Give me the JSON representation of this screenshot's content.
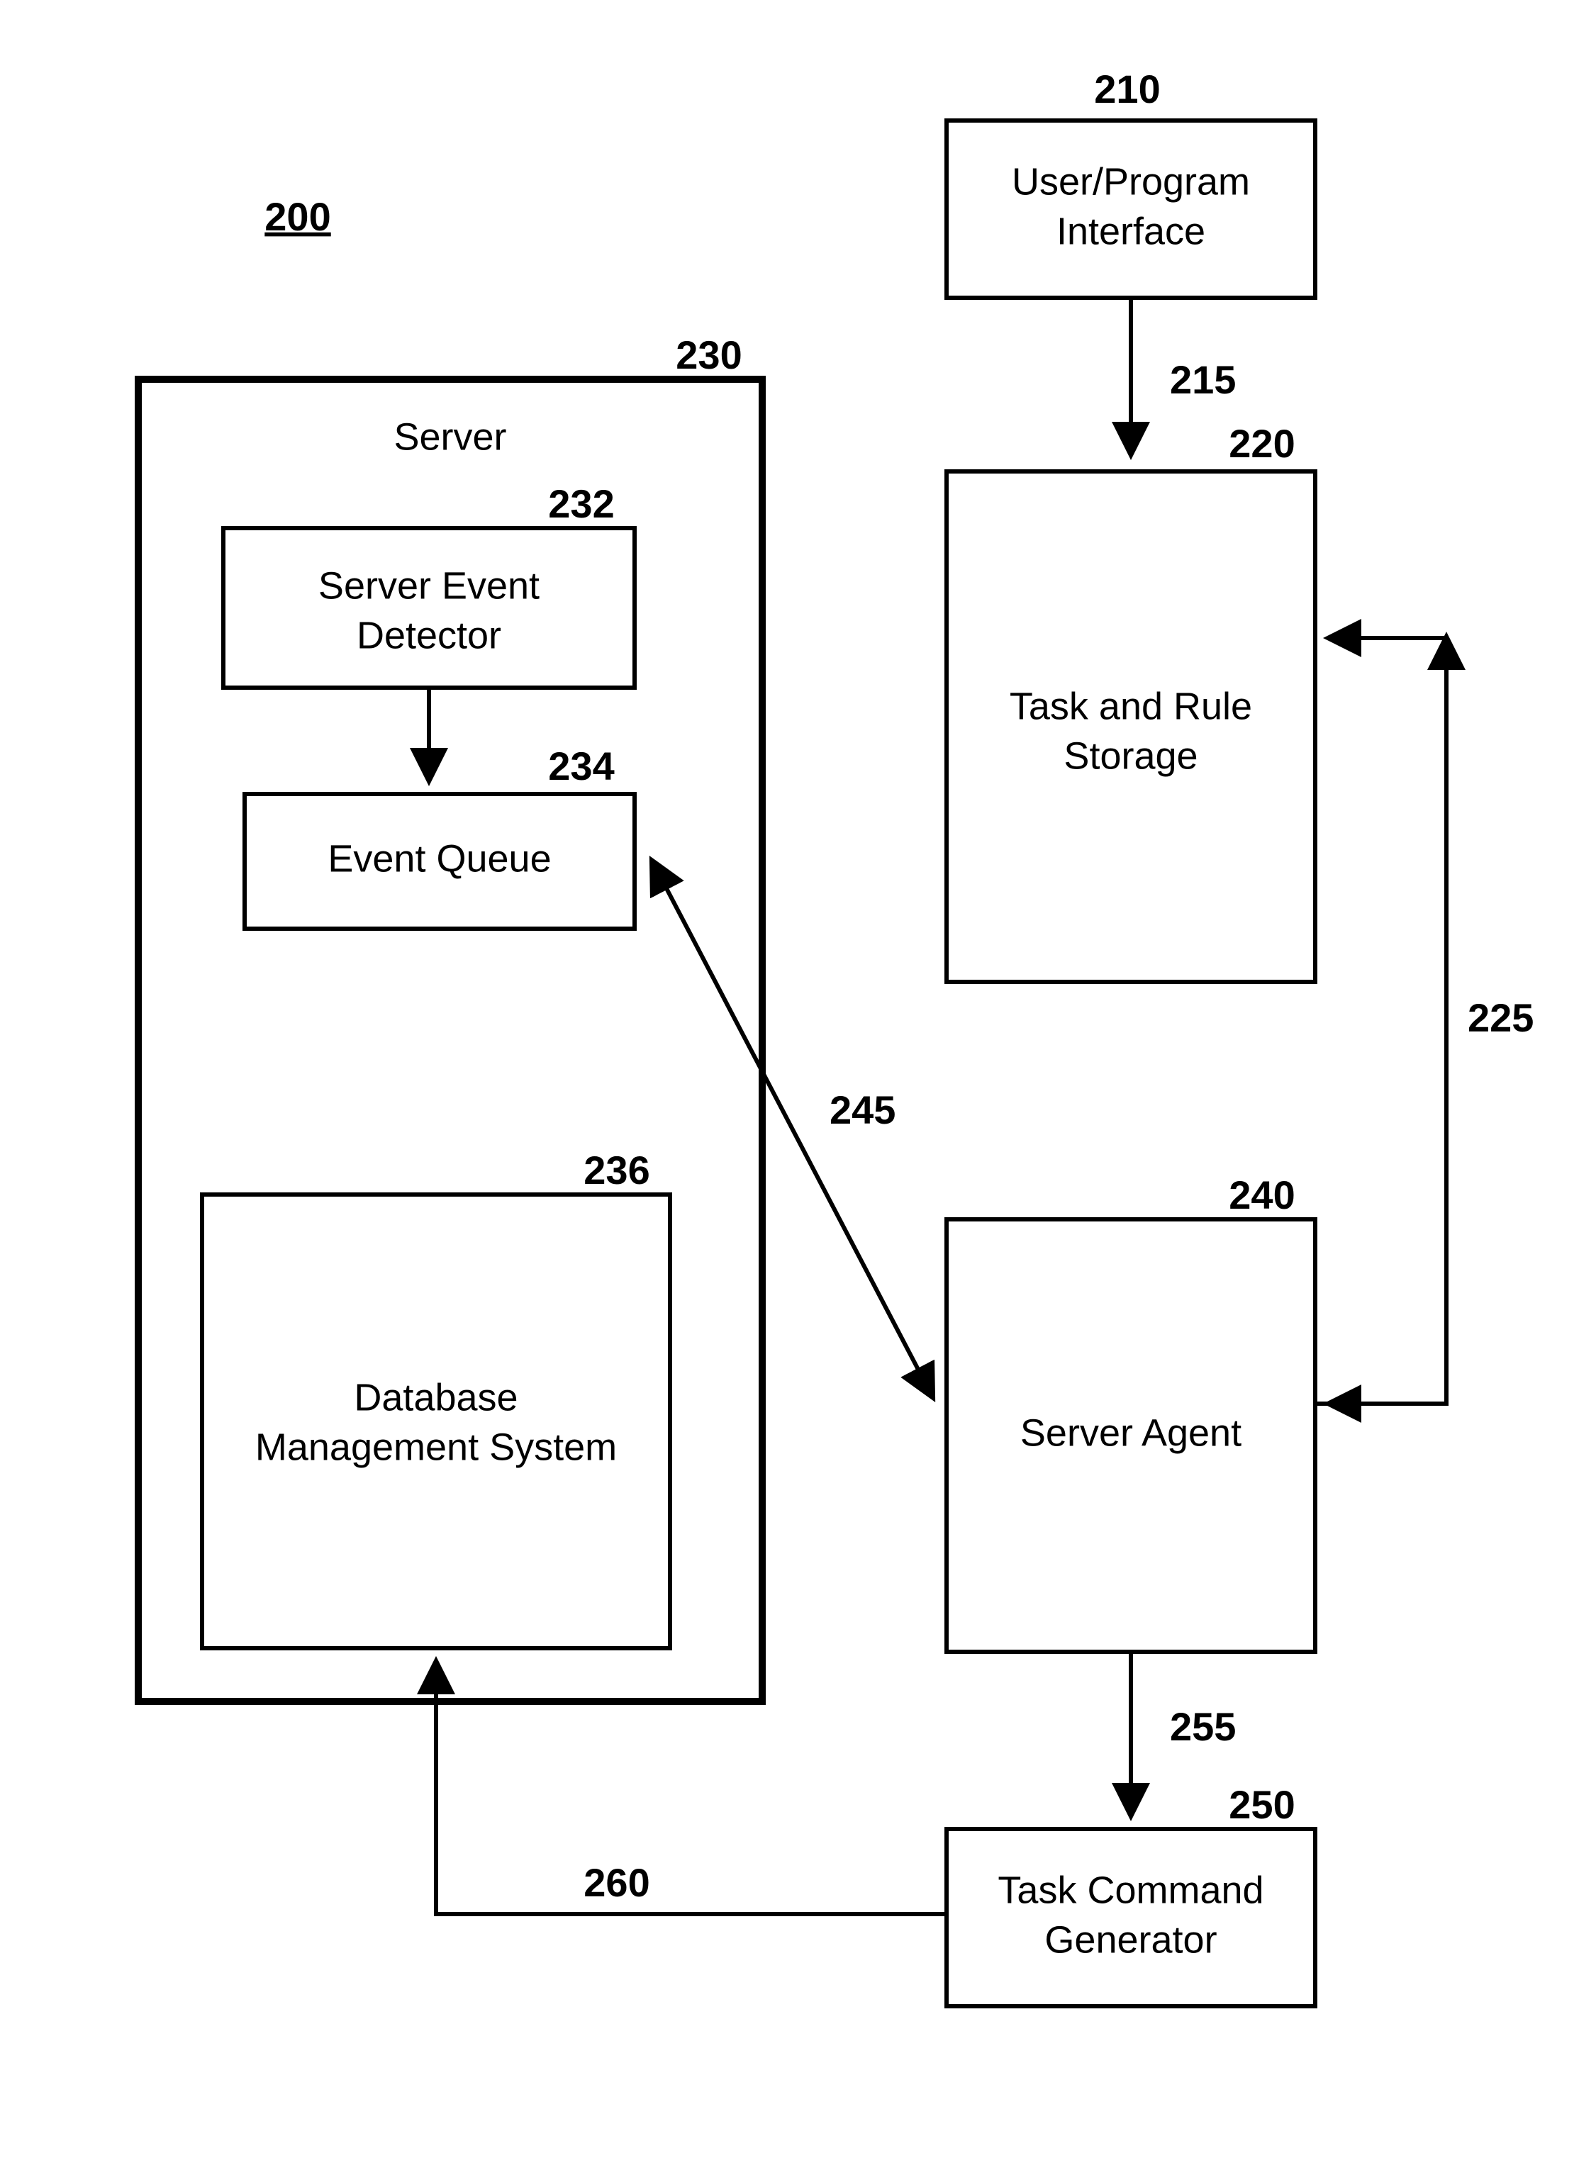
{
  "diagram_id": "200",
  "boxes": {
    "user_program_interface": {
      "ref": "210",
      "label_l1": "User/Program",
      "label_l2": "Interface"
    },
    "task_rule_storage": {
      "ref": "220",
      "label_l1": "Task and Rule",
      "label_l2": "Storage"
    },
    "server": {
      "ref": "230",
      "label": "Server"
    },
    "server_event_detector": {
      "ref": "232",
      "label_l1": "Server Event",
      "label_l2": "Detector"
    },
    "event_queue": {
      "ref": "234",
      "label": "Event Queue"
    },
    "dbms": {
      "ref": "236",
      "label_l1": "Database",
      "label_l2": "Management System"
    },
    "server_agent": {
      "ref": "240",
      "label": "Server Agent"
    },
    "task_command_generator": {
      "ref": "250",
      "label_l1": "Task Command",
      "label_l2": "Generator"
    }
  },
  "arrows": {
    "ui_to_storage": {
      "ref": "215"
    },
    "storage_agent_loop": {
      "ref": "225"
    },
    "queue_agent": {
      "ref": "245"
    },
    "agent_to_generator": {
      "ref": "255"
    },
    "generator_to_dbms": {
      "ref": "260"
    }
  }
}
